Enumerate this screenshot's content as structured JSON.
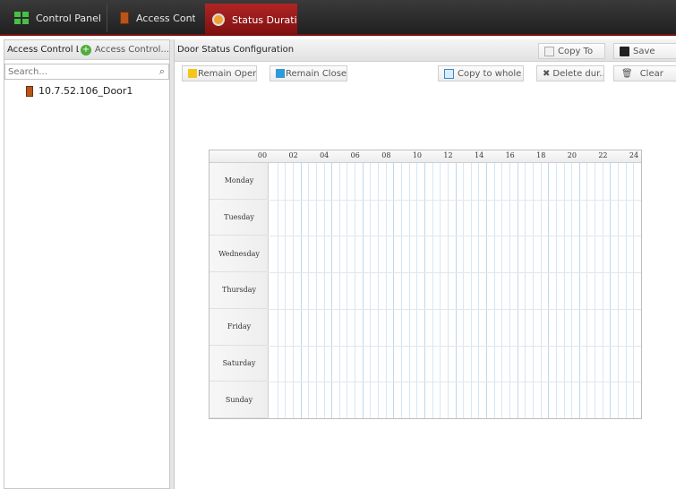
{
  "tabs": [
    {
      "label": "Control Panel",
      "icon": "grid-icon"
    },
    {
      "label": "Access Contr...",
      "icon": "door-icon"
    },
    {
      "label": "Status Duration",
      "icon": "clock-icon",
      "active": true
    }
  ],
  "left_panel": {
    "title": "Access Control Lis",
    "access_control_button": "Access Control...",
    "search_placeholder": "Search...",
    "devices": [
      "10.7.52.106_Door1"
    ]
  },
  "main": {
    "title": "Door Status Configuration",
    "copy_to": "Copy To",
    "save": "Save",
    "toolbar": {
      "remain_open": "Remain Open",
      "remain_closed": "Remain Closed",
      "copy_whole_week": "Copy to whole w...",
      "delete_duration": "Delete dur...",
      "clear": "Clear"
    },
    "colors": {
      "remain_open": "#f5c518",
      "remain_closed": "#2f9ad8",
      "active_tab": "#a01c1c"
    }
  },
  "schedule": {
    "hours": [
      "00",
      "02",
      "04",
      "06",
      "08",
      "10",
      "12",
      "14",
      "16",
      "18",
      "20",
      "22",
      "24"
    ],
    "days": [
      "Monday",
      "Tuesday",
      "Wednesday",
      "Thursday",
      "Friday",
      "Saturday",
      "Sunday"
    ]
  }
}
